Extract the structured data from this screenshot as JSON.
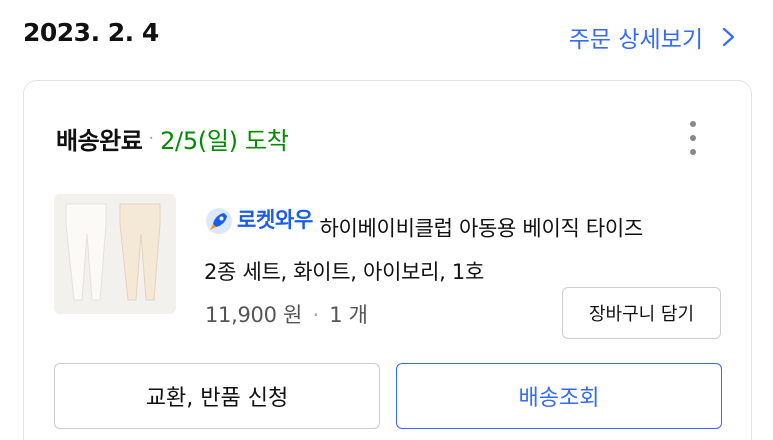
{
  "header": {
    "order_date": "2023. 2. 4",
    "detail_link_label": "주문 상세보기"
  },
  "order": {
    "status": "배송완료",
    "status_separator": "·",
    "arrival": "2/5(일) 도착",
    "badge": "로켓와우",
    "product_name_line1": "하이베이비클럽 아동용 베이직 타이즈",
    "product_name_line2": "2종 세트, 화이트, 아이보리, 1호",
    "price": "11,900 원",
    "qty_separator": "·",
    "quantity": "1 개",
    "cart_button_label": "장바구니 담기",
    "return_button_label": "교환, 반품 신청",
    "track_button_label": "배송조회"
  },
  "colors": {
    "accent": "#346aff",
    "arrival_green": "#008c00",
    "badge_blue": "#1a5ee8"
  },
  "icons": {
    "detail_arrow": "chevron-right-icon",
    "more": "more-vertical-icon",
    "badge": "rocket-icon"
  }
}
